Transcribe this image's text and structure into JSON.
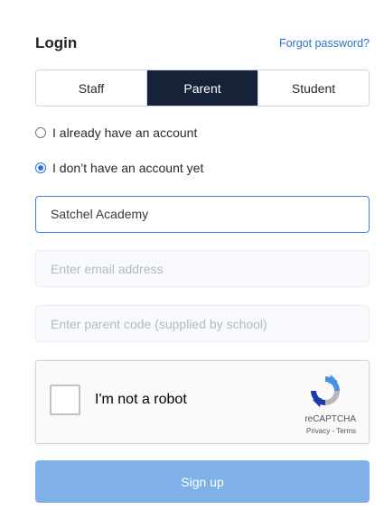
{
  "header": {
    "title": "Login",
    "forgot_link": "Forgot password?"
  },
  "tabs": [
    {
      "label": "Staff",
      "active": false
    },
    {
      "label": "Parent",
      "active": true
    },
    {
      "label": "Student",
      "active": false
    }
  ],
  "account_options": [
    {
      "label": "I already have an account",
      "checked": false
    },
    {
      "label": "I don’t have an account yet",
      "checked": true
    }
  ],
  "form": {
    "school_value": "Satchel Academy",
    "email_placeholder": "Enter email address",
    "email_value": "",
    "parent_code_placeholder": "Enter parent code (supplied by school)",
    "parent_code_value": ""
  },
  "captcha": {
    "label": "I'm not a robot",
    "brand": "reCAPTCHA",
    "links": "Privacy - Terms",
    "checked": false
  },
  "signup_label": "Sign up",
  "colors": {
    "active_tab": "#152238",
    "link": "#2a73c8",
    "signup_button": "#7fb1e8",
    "focus_border": "#3c82e6"
  }
}
